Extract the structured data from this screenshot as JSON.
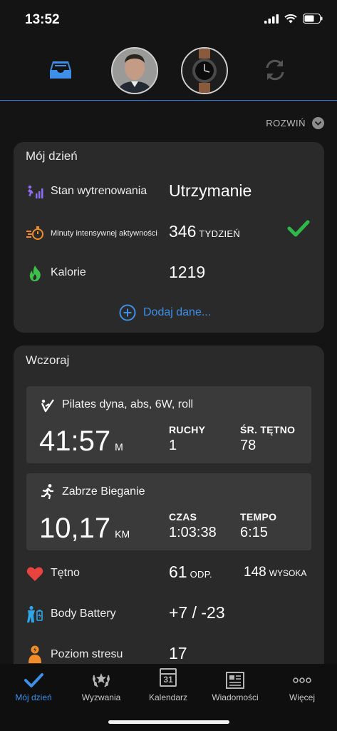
{
  "status_bar": {
    "time": "13:52"
  },
  "header": {
    "expand_label": "ROZWIŃ"
  },
  "my_day": {
    "title": "Mój dzień",
    "rows": [
      {
        "label": "Stan wytrenowania",
        "value": "Utrzymanie",
        "unit": ""
      },
      {
        "label": "Minuty intensywnej aktywności",
        "value": "346",
        "unit": "TYDZIEŃ"
      },
      {
        "label": "Kalorie",
        "value": "1219",
        "unit": ""
      }
    ],
    "add_data": "Dodaj dane..."
  },
  "yesterday": {
    "title": "Wczoraj",
    "activities": [
      {
        "name": "Pilates dyna, abs, 6W, roll",
        "big_value": "41:57",
        "big_unit": "M",
        "stat1_label": "RUCHY",
        "stat1_value": "1",
        "stat2_label": "ŚR. TĘTNO",
        "stat2_value": "78"
      },
      {
        "name": "Zabrze Bieganie",
        "big_value": "10,17",
        "big_unit": "KM",
        "stat1_label": "CZAS",
        "stat1_value": "1:03:38",
        "stat2_label": "TEMPO",
        "stat2_value": "6:15"
      }
    ],
    "rows": [
      {
        "label": "Tętno",
        "value": "61",
        "unit": "ODP.",
        "extra_value": "148",
        "extra_unit": "WYSOKA"
      },
      {
        "label": "Body Battery",
        "value": "+7 / -23"
      },
      {
        "label": "Poziom stresu",
        "value": "17"
      }
    ]
  },
  "tabs": [
    {
      "label": "Mój dzień",
      "icon": "check-icon",
      "active": true
    },
    {
      "label": "Wyzwania",
      "icon": "laurel-icon",
      "active": false
    },
    {
      "label": "Kalendarz",
      "icon": "calendar-icon",
      "active": false,
      "calendar_day": "31"
    },
    {
      "label": "Wiadomości",
      "icon": "newspaper-icon",
      "active": false
    },
    {
      "label": "Więcej",
      "icon": "more-icon",
      "active": false
    }
  ],
  "colors": {
    "accent": "#3d8fe8",
    "check_green": "#2fb84a",
    "training_purple": "#8d6cf0",
    "intensity_orange": "#f28c28",
    "calories_green": "#3cc04a",
    "heart_red": "#e8433f",
    "battery_blue": "#2fa6e8",
    "stress_orange": "#f28c28"
  }
}
